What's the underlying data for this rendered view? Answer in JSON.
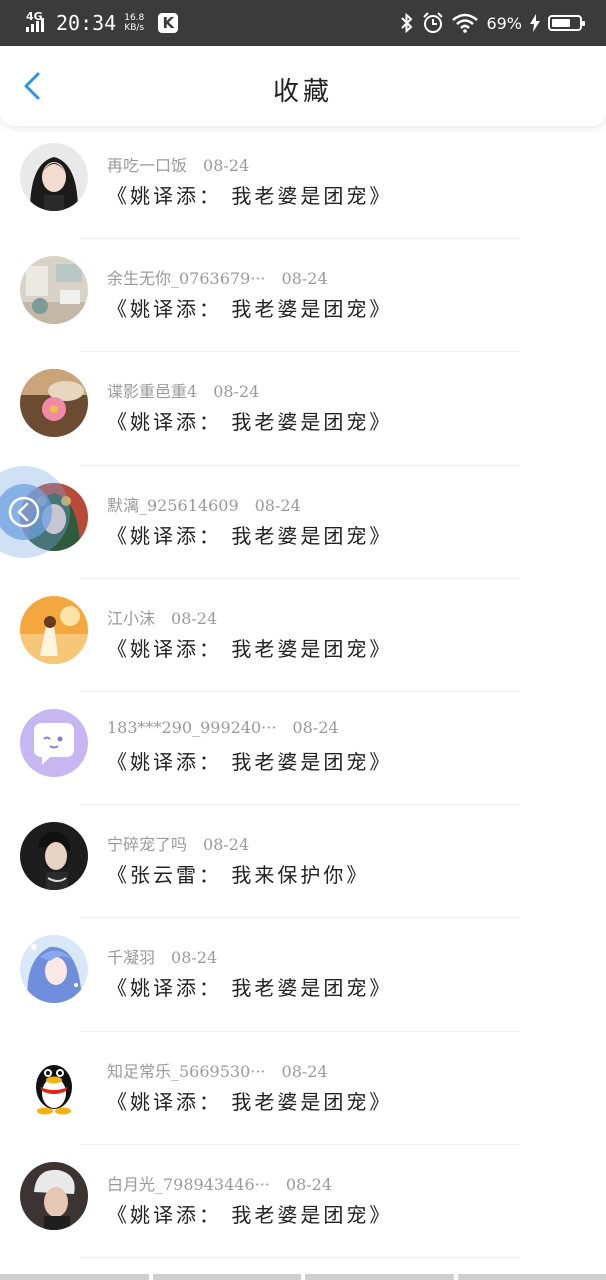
{
  "status_bar": {
    "network": "4G",
    "time": "20:34",
    "speed_value": "16.8",
    "speed_unit": "KB/s",
    "app_icon_letter": "K",
    "battery_percent": "69%",
    "battery_level": 0.69
  },
  "header": {
    "title": "收藏",
    "back_icon": "chevron-left-icon",
    "accent_color": "#2b95e9"
  },
  "favorites": [
    {
      "user": "再吃一口饭",
      "date": "08-24",
      "title": "《姚译添： 我老婆是团宠》"
    },
    {
      "user": "余生无你_0763679···",
      "date": "08-24",
      "title": "《姚译添： 我老婆是团宠》"
    },
    {
      "user": "谍影重邑重4",
      "date": "08-24",
      "title": "《姚译添： 我老婆是团宠》"
    },
    {
      "user": "默漓_925614609",
      "date": "08-24",
      "title": "《姚译添： 我老婆是团宠》"
    },
    {
      "user": "江小沫",
      "date": "08-24",
      "title": "《姚译添： 我老婆是团宠》"
    },
    {
      "user": "183***290_999240···",
      "date": "08-24",
      "title": "《姚译添： 我老婆是团宠》"
    },
    {
      "user": "宁碎宠了吗",
      "date": "08-24",
      "title": "《张云雷： 我来保护你》"
    },
    {
      "user": "千凝羽",
      "date": "08-24",
      "title": "《姚译添： 我老婆是团宠》"
    },
    {
      "user": "知足常乐_5669530···",
      "date": "08-24",
      "title": "《姚译添： 我老婆是团宠》"
    },
    {
      "user": "白月光_798943446···",
      "date": "08-24",
      "title": "《姚译添： 我老婆是团宠》"
    }
  ]
}
